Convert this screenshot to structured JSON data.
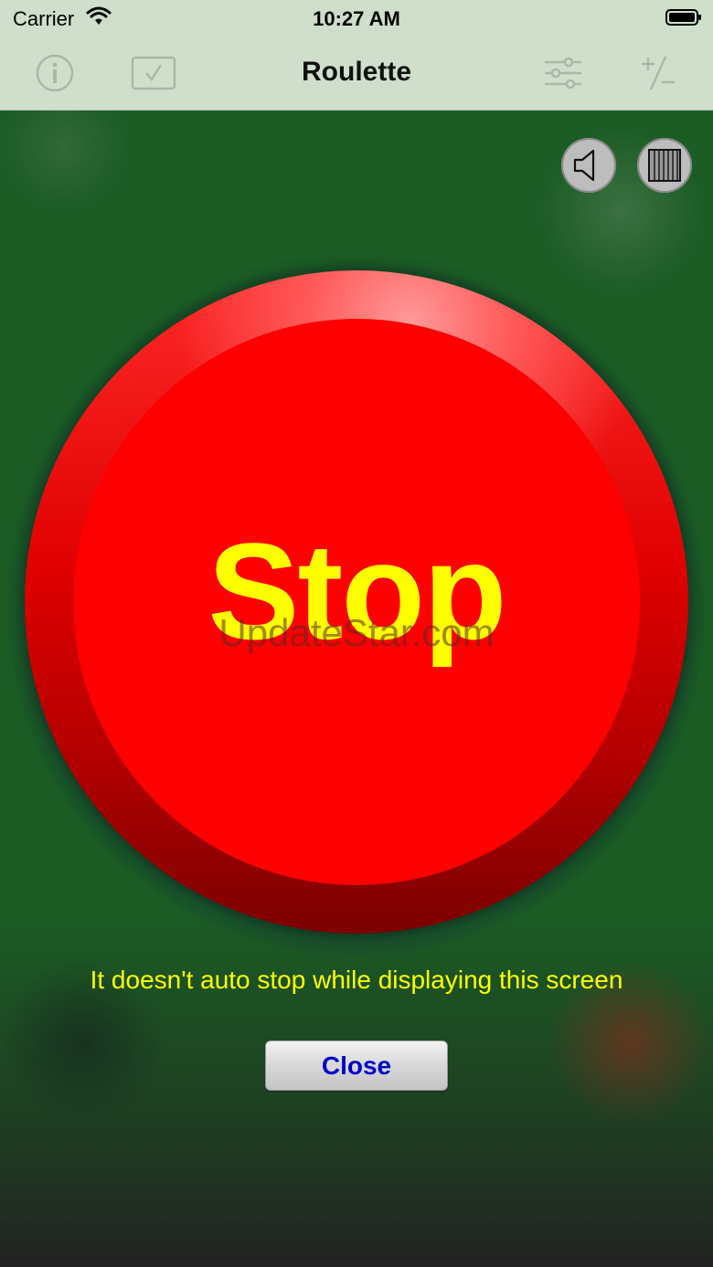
{
  "status_bar": {
    "carrier": "Carrier",
    "time": "10:27 AM"
  },
  "nav_bar": {
    "title": "Roulette",
    "left_icons": [
      "info-icon",
      "checkmark-box-icon"
    ],
    "right_icons": [
      "sliders-icon",
      "plus-minus-icon"
    ]
  },
  "main": {
    "controls": {
      "sound_icon": "speaker-icon",
      "grid_icon": "bars-grid-icon"
    },
    "stop_button": {
      "label": "Stop",
      "color": "#ff0000",
      "label_color": "#ffff00"
    },
    "watermark": "UpdateStar.com",
    "note": "It doesn't auto stop while displaying this screen",
    "close_button": {
      "label": "Close",
      "label_color": "#0000cc"
    }
  },
  "colors": {
    "header_bg": "#cfdfcb",
    "table_green": "#1c5c25",
    "accent_yellow": "#ffff00"
  }
}
